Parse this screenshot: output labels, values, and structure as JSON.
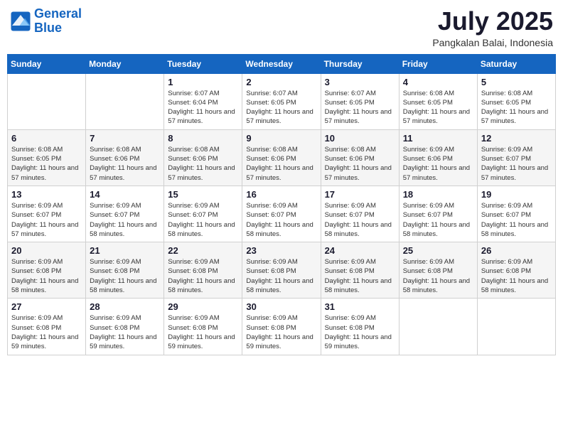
{
  "logo": {
    "line1": "General",
    "line2": "Blue"
  },
  "header": {
    "month_year": "July 2025",
    "location": "Pangkalan Balai, Indonesia"
  },
  "weekdays": [
    "Sunday",
    "Monday",
    "Tuesday",
    "Wednesday",
    "Thursday",
    "Friday",
    "Saturday"
  ],
  "weeks": [
    [
      {
        "day": "",
        "info": ""
      },
      {
        "day": "",
        "info": ""
      },
      {
        "day": "1",
        "info": "Sunrise: 6:07 AM\nSunset: 6:04 PM\nDaylight: 11 hours and 57 minutes."
      },
      {
        "day": "2",
        "info": "Sunrise: 6:07 AM\nSunset: 6:05 PM\nDaylight: 11 hours and 57 minutes."
      },
      {
        "day": "3",
        "info": "Sunrise: 6:07 AM\nSunset: 6:05 PM\nDaylight: 11 hours and 57 minutes."
      },
      {
        "day": "4",
        "info": "Sunrise: 6:08 AM\nSunset: 6:05 PM\nDaylight: 11 hours and 57 minutes."
      },
      {
        "day": "5",
        "info": "Sunrise: 6:08 AM\nSunset: 6:05 PM\nDaylight: 11 hours and 57 minutes."
      }
    ],
    [
      {
        "day": "6",
        "info": "Sunrise: 6:08 AM\nSunset: 6:05 PM\nDaylight: 11 hours and 57 minutes."
      },
      {
        "day": "7",
        "info": "Sunrise: 6:08 AM\nSunset: 6:06 PM\nDaylight: 11 hours and 57 minutes."
      },
      {
        "day": "8",
        "info": "Sunrise: 6:08 AM\nSunset: 6:06 PM\nDaylight: 11 hours and 57 minutes."
      },
      {
        "day": "9",
        "info": "Sunrise: 6:08 AM\nSunset: 6:06 PM\nDaylight: 11 hours and 57 minutes."
      },
      {
        "day": "10",
        "info": "Sunrise: 6:08 AM\nSunset: 6:06 PM\nDaylight: 11 hours and 57 minutes."
      },
      {
        "day": "11",
        "info": "Sunrise: 6:09 AM\nSunset: 6:06 PM\nDaylight: 11 hours and 57 minutes."
      },
      {
        "day": "12",
        "info": "Sunrise: 6:09 AM\nSunset: 6:07 PM\nDaylight: 11 hours and 57 minutes."
      }
    ],
    [
      {
        "day": "13",
        "info": "Sunrise: 6:09 AM\nSunset: 6:07 PM\nDaylight: 11 hours and 57 minutes."
      },
      {
        "day": "14",
        "info": "Sunrise: 6:09 AM\nSunset: 6:07 PM\nDaylight: 11 hours and 58 minutes."
      },
      {
        "day": "15",
        "info": "Sunrise: 6:09 AM\nSunset: 6:07 PM\nDaylight: 11 hours and 58 minutes."
      },
      {
        "day": "16",
        "info": "Sunrise: 6:09 AM\nSunset: 6:07 PM\nDaylight: 11 hours and 58 minutes."
      },
      {
        "day": "17",
        "info": "Sunrise: 6:09 AM\nSunset: 6:07 PM\nDaylight: 11 hours and 58 minutes."
      },
      {
        "day": "18",
        "info": "Sunrise: 6:09 AM\nSunset: 6:07 PM\nDaylight: 11 hours and 58 minutes."
      },
      {
        "day": "19",
        "info": "Sunrise: 6:09 AM\nSunset: 6:07 PM\nDaylight: 11 hours and 58 minutes."
      }
    ],
    [
      {
        "day": "20",
        "info": "Sunrise: 6:09 AM\nSunset: 6:08 PM\nDaylight: 11 hours and 58 minutes."
      },
      {
        "day": "21",
        "info": "Sunrise: 6:09 AM\nSunset: 6:08 PM\nDaylight: 11 hours and 58 minutes."
      },
      {
        "day": "22",
        "info": "Sunrise: 6:09 AM\nSunset: 6:08 PM\nDaylight: 11 hours and 58 minutes."
      },
      {
        "day": "23",
        "info": "Sunrise: 6:09 AM\nSunset: 6:08 PM\nDaylight: 11 hours and 58 minutes."
      },
      {
        "day": "24",
        "info": "Sunrise: 6:09 AM\nSunset: 6:08 PM\nDaylight: 11 hours and 58 minutes."
      },
      {
        "day": "25",
        "info": "Sunrise: 6:09 AM\nSunset: 6:08 PM\nDaylight: 11 hours and 58 minutes."
      },
      {
        "day": "26",
        "info": "Sunrise: 6:09 AM\nSunset: 6:08 PM\nDaylight: 11 hours and 58 minutes."
      }
    ],
    [
      {
        "day": "27",
        "info": "Sunrise: 6:09 AM\nSunset: 6:08 PM\nDaylight: 11 hours and 59 minutes."
      },
      {
        "day": "28",
        "info": "Sunrise: 6:09 AM\nSunset: 6:08 PM\nDaylight: 11 hours and 59 minutes."
      },
      {
        "day": "29",
        "info": "Sunrise: 6:09 AM\nSunset: 6:08 PM\nDaylight: 11 hours and 59 minutes."
      },
      {
        "day": "30",
        "info": "Sunrise: 6:09 AM\nSunset: 6:08 PM\nDaylight: 11 hours and 59 minutes."
      },
      {
        "day": "31",
        "info": "Sunrise: 6:09 AM\nSunset: 6:08 PM\nDaylight: 11 hours and 59 minutes."
      },
      {
        "day": "",
        "info": ""
      },
      {
        "day": "",
        "info": ""
      }
    ]
  ]
}
